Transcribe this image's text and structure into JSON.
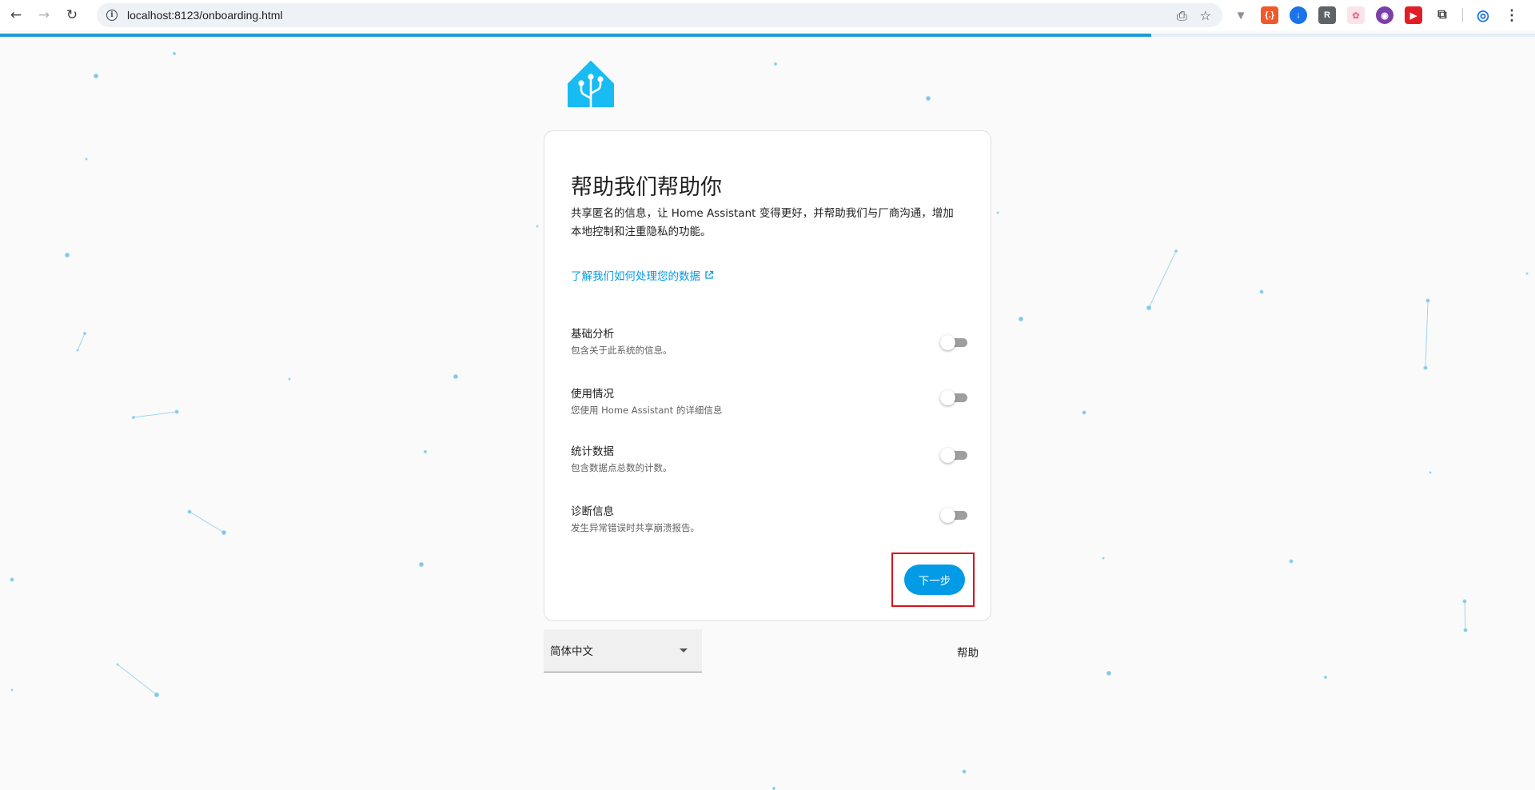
{
  "browser": {
    "url": "localhost:8123/onboarding.html",
    "page_load_progress": 0.75
  },
  "onboarding": {
    "title": "帮助我们帮助你",
    "description": "共享匿名的信息，让 Home Assistant 变得更好，并帮助我们与厂商沟通，增加本地控制和注重隐私的功能。",
    "data_link_label": "了解我们如何处理您的数据",
    "options": [
      {
        "title": "基础分析",
        "description": "包含关于此系统的信息。",
        "enabled": false
      },
      {
        "title": "使用情况",
        "description": "您使用 Home Assistant 的详细信息",
        "enabled": false
      },
      {
        "title": "统计数据",
        "description": "包含数据点总数的计数。",
        "enabled": false
      },
      {
        "title": "诊断信息",
        "description": "发生异常错误时共享崩溃报告。",
        "enabled": false
      }
    ],
    "next_label": "下一步"
  },
  "footer": {
    "language": "简体中文",
    "help_label": "帮助"
  },
  "colors": {
    "brand": "#18bcf2",
    "accent": "#039be5",
    "highlight": "#d9121b"
  }
}
